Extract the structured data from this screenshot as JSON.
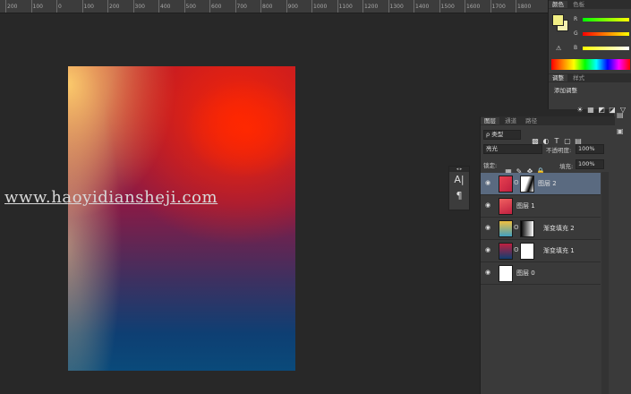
{
  "ruler": {
    "ticks": [
      "200",
      "100",
      "0",
      "100",
      "200",
      "300",
      "400",
      "500",
      "600",
      "700",
      "800",
      "900",
      "1000",
      "1100",
      "1200",
      "1300",
      "1400",
      "1500",
      "1600",
      "1700",
      "1800"
    ]
  },
  "watermark": "www.haoyidiansheji.com",
  "mini_tools": {
    "a_icon": "A|",
    "para_icon": "¶"
  },
  "color_panel": {
    "tabs": [
      "颜色",
      "色板"
    ],
    "channels": [
      {
        "label": "R",
        "gradient": "linear-gradient(90deg,#00ff00,#ffff00)"
      },
      {
        "label": "G",
        "gradient": "linear-gradient(90deg,#ff0000,#ffff00)"
      },
      {
        "label": "B",
        "gradient": "linear-gradient(90deg,#ffff00,#ffffff)"
      }
    ],
    "fg_color": "#f2ef84",
    "bg_color": "#f4f1b0"
  },
  "adjustments": {
    "tabs": [
      "调整",
      "样式"
    ],
    "title": "添加调整",
    "icons": [
      "☀",
      "▦",
      "◩",
      "◪",
      "▽"
    ]
  },
  "layers": {
    "tabs": [
      "图层",
      "通道",
      "路径"
    ],
    "filter_label": "ρ 类型",
    "blend_mode": "亮光",
    "opacity_label": "不透明度:",
    "opacity_value": "100%",
    "lock_label": "锁定:",
    "fill_label": "填充:",
    "fill_value": "100%",
    "rows": [
      {
        "name": "图层 2",
        "selected": true
      },
      {
        "name": "图层 1",
        "selected": false
      },
      {
        "name": "渐变填充 2",
        "selected": false
      },
      {
        "name": "渐变填充 1",
        "selected": false
      },
      {
        "name": "图层 0",
        "selected": false
      }
    ]
  }
}
